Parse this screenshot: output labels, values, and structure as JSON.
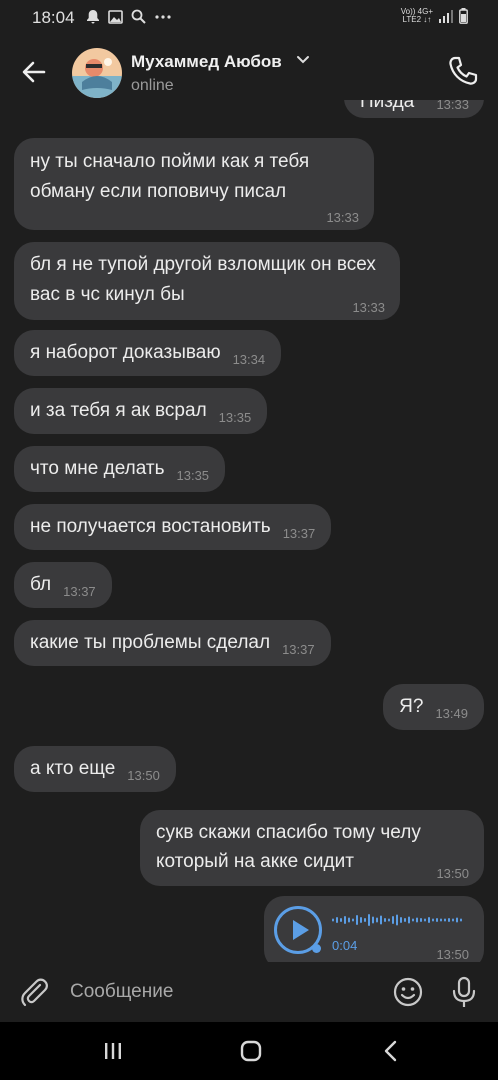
{
  "status_bar": {
    "time": "18:04",
    "network_top": "Vo))  4G+",
    "network_bottom": "LTE2 ↓↑",
    "icons": [
      "notification-bell-icon",
      "image-icon",
      "search-icon",
      "more-dots-icon",
      "signal-icon",
      "battery-icon"
    ]
  },
  "header": {
    "contact_name": "Мухаммед Аюбов",
    "contact_status": "online",
    "icons": [
      "back-arrow-icon",
      "chevron-down-icon",
      "phone-icon"
    ]
  },
  "messages": [
    {
      "dir": "in",
      "text": "ну ты сначало пойми как я тебя обману если поповичу писал",
      "time": "13:33"
    },
    {
      "dir": "in",
      "text": "бл я не тупой другой взломщик он всех вас в чс кинул бы",
      "time": "13:33"
    },
    {
      "dir": "in",
      "text": "я наборот доказываю",
      "time": "13:34"
    },
    {
      "dir": "in",
      "text": "и за тебя я ак всрал",
      "time": "13:35"
    },
    {
      "dir": "in",
      "text": "что мне делать",
      "time": "13:35"
    },
    {
      "dir": "in",
      "text": "не получается востановить",
      "time": "13:37"
    },
    {
      "dir": "in",
      "text": "бл",
      "time": "13:37"
    },
    {
      "dir": "in",
      "text": "какие ты проблемы сделал",
      "time": "13:37"
    },
    {
      "dir": "out",
      "text": "Я?",
      "time": "13:49"
    },
    {
      "dir": "in",
      "text": "а кто еще",
      "time": "13:50"
    },
    {
      "dir": "out",
      "text": "сукв скажи спасибо тому челу который на акке сидит",
      "time": "13:50"
    }
  ],
  "top_partial_message": {
    "text": "Пизда",
    "time": "13:33"
  },
  "voice_message": {
    "duration": "0:04",
    "time": "13:50",
    "progress": 0.0
  },
  "composer": {
    "placeholder": "Сообщение",
    "icons": [
      "paperclip-icon",
      "emoji-icon",
      "microphone-icon"
    ]
  },
  "navbar": {
    "icons": [
      "recent-apps-icon",
      "home-icon",
      "back-icon"
    ]
  },
  "colors": {
    "background": "#1e1e1e",
    "bubble": "#3a3a3c",
    "accent": "#5b9ee6",
    "time_text": "#8c8c8c"
  }
}
